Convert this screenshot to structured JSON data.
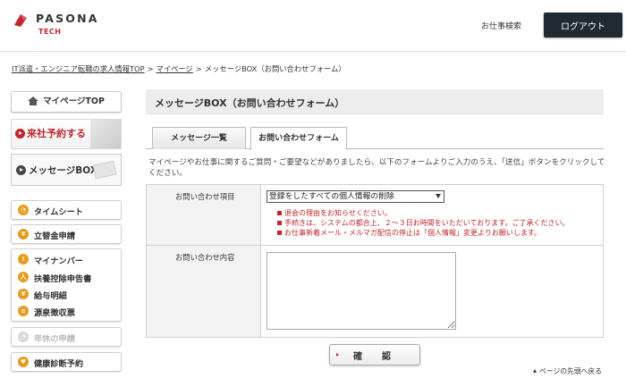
{
  "header": {
    "brand": "PASONA",
    "brand_sub": "TECH",
    "job_search_label": "お仕事検索",
    "logout_label": "ログアウト",
    "colors": {
      "brand_red": "#c0262d",
      "logout_bg": "#1f2a33"
    }
  },
  "breadcrumb": {
    "items": [
      "IT派遣・エンジニア転職の求人情報TOP",
      "マイページ",
      "メッセージBOX（お問い合わせフォーム）"
    ],
    "separator": ">"
  },
  "sidebar": {
    "mypage_top": "マイページTOP",
    "visit_reservation": "来社予約する",
    "message_box": "メッセージBOX",
    "groups": [
      {
        "items": [
          {
            "label": "タイムシート",
            "icon": "clock-icon"
          }
        ]
      },
      {
        "items": [
          {
            "label": "立替金申請",
            "icon": "yen-icon"
          }
        ]
      },
      {
        "items": [
          {
            "label": "マイナンバー",
            "icon": "number-icon"
          },
          {
            "label": "扶養控除申告書",
            "icon": "family-icon"
          },
          {
            "label": "給与明細",
            "icon": "yen-icon"
          },
          {
            "label": "源泉徴収票",
            "icon": "document-icon"
          }
        ]
      },
      {
        "items": [
          {
            "label": "年休の申請",
            "icon": "clock-icon",
            "disabled": true
          }
        ]
      },
      {
        "items": [
          {
            "label": "健康診断予約",
            "icon": "heart-icon"
          }
        ]
      }
    ]
  },
  "main": {
    "title": "メッセージBOX（お問い合わせフォーム）",
    "tabs": [
      {
        "label": "メッセージ一覧",
        "active": false
      },
      {
        "label": "お問い合わせフォーム",
        "active": true
      }
    ],
    "intro": "マイページやお仕事に関するご質問・ご要望などがありましたら、以下のフォームよりご入力のうえ、「送信」ボタンをクリックしてください。",
    "form": {
      "item_label": "お問い合わせ項目",
      "item_selected": "登録をしたすべての個人情報の削除",
      "notes": [
        "退会の理由をお知らせください。",
        "手続きは、システムの都合上、２～３日お時間をいただいております。ご了承ください。",
        "お仕事新着メール・メルマガ配信の停止は「個人情報」変更よりお願いします。"
      ],
      "content_label": "お問い合わせ内容",
      "content_value": ""
    },
    "confirm_label": "確　認",
    "to_top_label": "ページの先頭へ戻る"
  }
}
